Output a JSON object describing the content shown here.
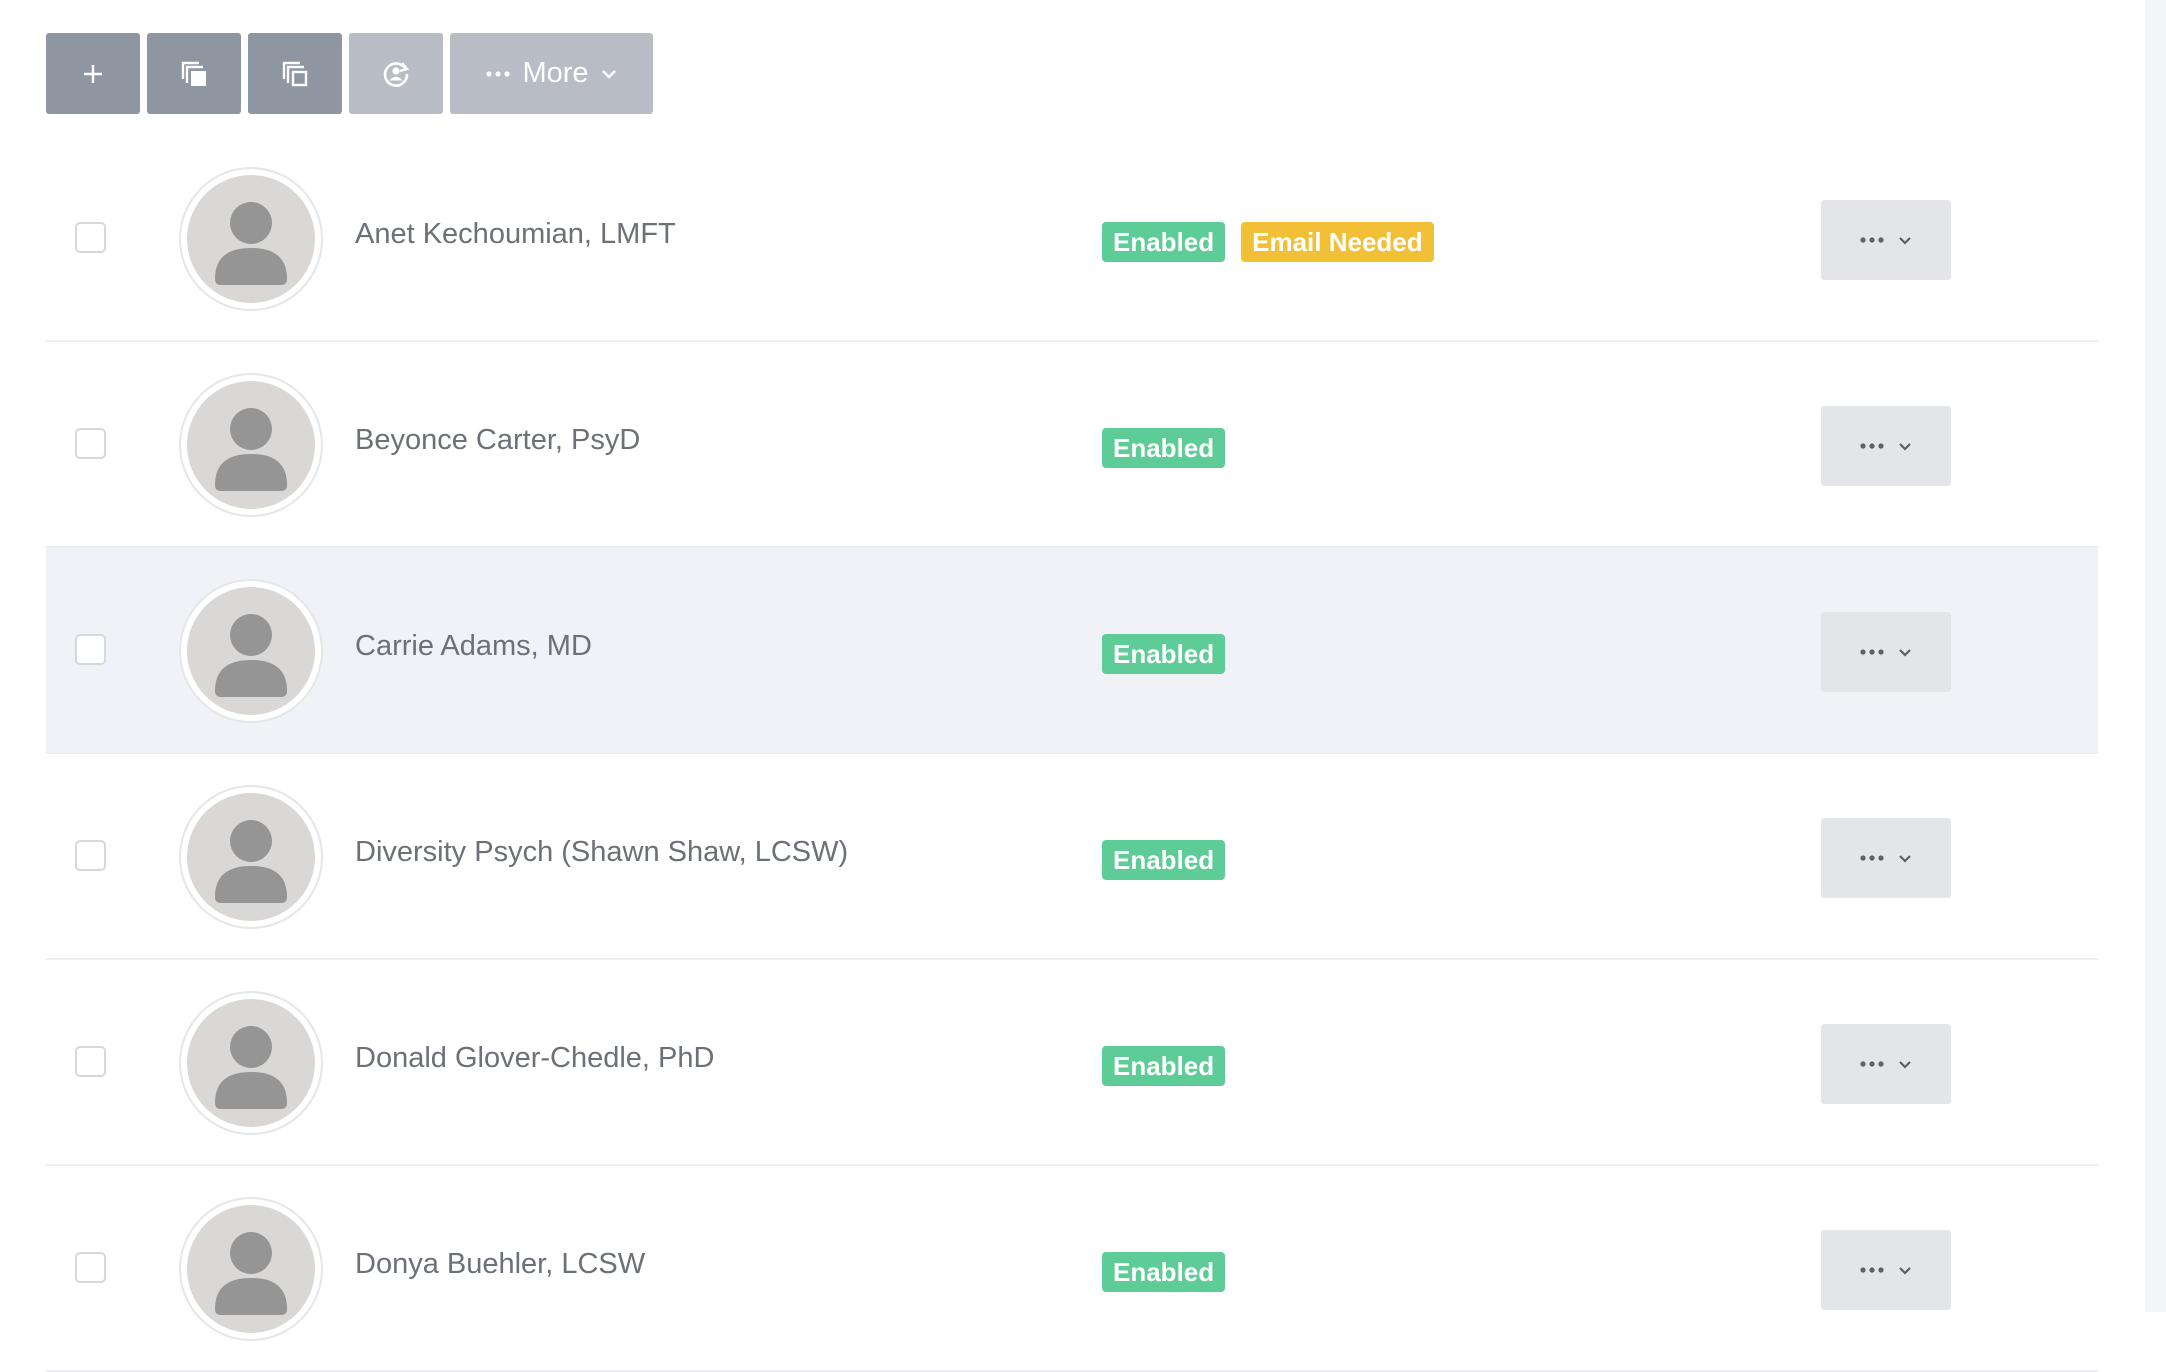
{
  "toolbar": {
    "buttons": [
      {
        "name": "add-button",
        "icon": "plus-icon"
      },
      {
        "name": "copy-button",
        "icon": "copy-filled-icon"
      },
      {
        "name": "duplicate-button",
        "icon": "copy-outline-icon"
      },
      {
        "name": "reset-button",
        "icon": "user-refresh-icon"
      }
    ],
    "more_label": "More",
    "more_icon": "ellipsis-icon",
    "more_chevron": "chevron-down-icon"
  },
  "providers": [
    {
      "name": "Anet Kechoumian, LMFT",
      "badges": [
        "Enabled",
        "Email Needed"
      ],
      "highlighted": false
    },
    {
      "name": "Beyonce Carter, PsyD",
      "badges": [
        "Enabled"
      ],
      "highlighted": false
    },
    {
      "name": "Carrie Adams, MD",
      "badges": [
        "Enabled"
      ],
      "highlighted": true
    },
    {
      "name": "Diversity Psych (Shawn Shaw, LCSW)",
      "badges": [
        "Enabled"
      ],
      "highlighted": false
    },
    {
      "name": "Donald Glover-Chedle, PhD",
      "badges": [
        "Enabled"
      ],
      "highlighted": false
    },
    {
      "name": "Donya Buehler, LCSW",
      "badges": [
        "Enabled"
      ],
      "highlighted": false
    }
  ],
  "colors": {
    "enabled_badge": "#5dcc97",
    "email_needed_badge": "#f1c037",
    "toolbar_button": "#8e96a1",
    "toolbar_button_light": "#b8bdc5",
    "highlight_row": "#f0f2f7"
  }
}
